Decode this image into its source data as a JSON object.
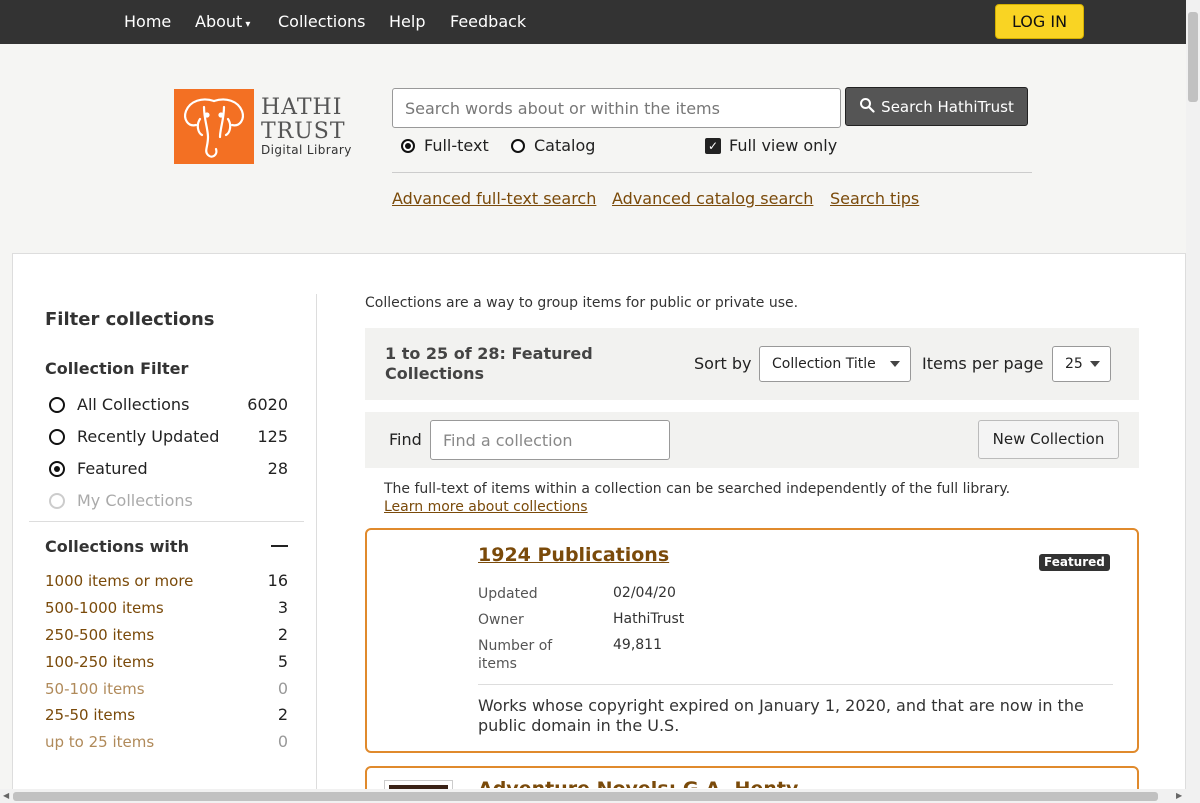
{
  "nav": {
    "items": [
      "Home",
      "About",
      "Collections",
      "Help",
      "Feedback"
    ],
    "about_caret": "▾",
    "login_label": "LOG IN"
  },
  "logo": {
    "word1": "HATHI",
    "word2": "TRUST",
    "subtitle": "Digital Library",
    "brand_color": "#f37023"
  },
  "search": {
    "placeholder": "Search words about or within the items",
    "button_label": "Search HathiTrust",
    "options": {
      "fulltext": "Full-text",
      "catalog": "Catalog",
      "selected": "Full-text"
    },
    "full_view_label": "Full view only",
    "full_view_checked": true,
    "links": [
      "Advanced full-text search",
      "Advanced catalog search",
      "Search tips"
    ]
  },
  "sidebar": {
    "title": "Filter collections",
    "filter_heading": "Collection Filter",
    "filters": [
      {
        "label": "All Collections",
        "count": "6020",
        "selected": false,
        "enabled": true
      },
      {
        "label": "Recently Updated",
        "count": "125",
        "selected": false,
        "enabled": true
      },
      {
        "label": "Featured",
        "count": "28",
        "selected": true,
        "enabled": true
      },
      {
        "label": "My Collections",
        "count": "",
        "selected": false,
        "enabled": false
      }
    ],
    "with_heading": "Collections with",
    "sizes": [
      {
        "label": "1000 items or more",
        "count": "16"
      },
      {
        "label": "500-1000 items",
        "count": "3"
      },
      {
        "label": "250-500 items",
        "count": "2"
      },
      {
        "label": "100-250 items",
        "count": "5"
      },
      {
        "label": "50-100 items",
        "count": "0"
      },
      {
        "label": "25-50 items",
        "count": "2"
      },
      {
        "label": "up to 25 items",
        "count": "0"
      }
    ]
  },
  "main": {
    "intro": "Collections are a way to group items for public or private use.",
    "results_summary": "1 to 25 of 28: Featured Collections",
    "sort_label": "Sort by",
    "sort_value": "Collection Title",
    "ipp_label": "Items per page",
    "ipp_value": "25",
    "find_label": "Find",
    "find_placeholder": "Find a collection",
    "new_collection_label": "New Collection",
    "note": "The full-text of items within a collection can be searched independently of the full library.",
    "note_link": "Learn more about collections",
    "collections": [
      {
        "title": "1924 Publications",
        "badge": "Featured",
        "meta": [
          {
            "key": "Updated",
            "value": "02/04/20"
          },
          {
            "key": "Owner",
            "value": "HathiTrust"
          },
          {
            "key": "Number of items",
            "value": "49,811"
          }
        ],
        "description": "Works whose copyright expired on January 1, 2020, and that are now in the public domain in the U.S."
      },
      {
        "title": "Adventure Novels: G.A. Henty"
      }
    ]
  }
}
